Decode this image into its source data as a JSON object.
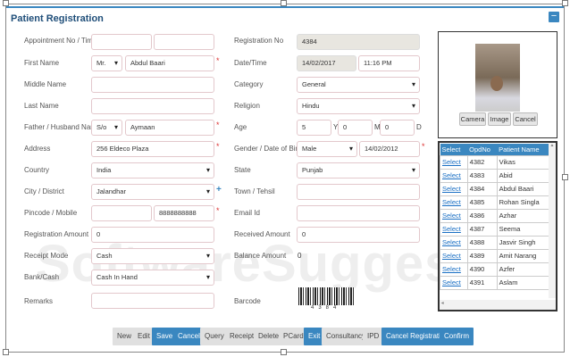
{
  "title": "Patient Registration",
  "collapse_label": "−",
  "left": {
    "appointment": {
      "label": "Appointment No / Time",
      "no": "",
      "time": ""
    },
    "first_name": {
      "label": "First Name",
      "prefix": "Mr.",
      "value": "Abdul Baari",
      "req": "*"
    },
    "middle_name": {
      "label": "Middle Name",
      "value": ""
    },
    "last_name": {
      "label": "Last Name",
      "value": ""
    },
    "father": {
      "label": "Father / Husband Name",
      "prefix": "S/o",
      "value": "Aymaan",
      "req": "*"
    },
    "address": {
      "label": "Address",
      "value": "256 Eldeco Plaza",
      "req": "*"
    },
    "country": {
      "label": "Country",
      "value": "India"
    },
    "city": {
      "label": "City / District",
      "value": "Jalandhar",
      "plus": "+"
    },
    "pincode": {
      "label": "Pincode / Mobile",
      "pincode": "",
      "mobile": "8888888888",
      "req": "*"
    },
    "reg_amount": {
      "label": "Registration Amount",
      "value": "0"
    },
    "receipt_mode": {
      "label": "Receipt Mode",
      "value": "Cash"
    },
    "bank": {
      "label": "Bank/Cash",
      "value": "Cash In Hand"
    },
    "remarks": {
      "label": "Remarks",
      "value": ""
    }
  },
  "right": {
    "reg_no": {
      "label": "Registration No",
      "value": "4384"
    },
    "datetime": {
      "label": "Date/Time",
      "date": "14/02/2017",
      "time": "11:16 PM"
    },
    "category": {
      "label": "Category",
      "value": "General"
    },
    "religion": {
      "label": "Religion",
      "value": "Hindu"
    },
    "age": {
      "label": "Age",
      "y": "5",
      "m": "0",
      "d": "0",
      "y_unit": "Y",
      "m_unit": "M",
      "d_unit": "D"
    },
    "gender": {
      "label": "Gender / Date of Birth",
      "gender": "Male",
      "dob": "14/02/2012",
      "req": "*"
    },
    "state": {
      "label": "State",
      "value": "Punjab"
    },
    "town": {
      "label": "Town / Tehsil",
      "value": ""
    },
    "email": {
      "label": "Email Id",
      "value": ""
    },
    "received": {
      "label": "Received Amount",
      "value": "0"
    },
    "balance": {
      "label": "Balance Amount",
      "value": "0"
    },
    "barcode": {
      "label": "Barcode",
      "digits": "4384"
    }
  },
  "photo": {
    "camera": "Camera",
    "image": "Image",
    "cancel": "Cancel"
  },
  "patients": {
    "headers": [
      "Select",
      "OpdNo",
      "Patient Name"
    ],
    "link": "Select",
    "rows": [
      [
        "4382",
        "Vikas"
      ],
      [
        "4383",
        "Abid"
      ],
      [
        "4384",
        "Abdul Baari"
      ],
      [
        "4385",
        "Rohan Singla"
      ],
      [
        "4386",
        "Azhar"
      ],
      [
        "4387",
        "Seema"
      ],
      [
        "4388",
        "Jasvir Singh"
      ],
      [
        "4389",
        "Amit Narang"
      ],
      [
        "4390",
        "Azfer"
      ],
      [
        "4391",
        "Aslam"
      ]
    ]
  },
  "buttons": [
    "New",
    "Edit",
    "Save",
    "Cancel",
    "Query",
    "Receipt",
    "Delete",
    "PCard",
    "Exit",
    "Consultancy",
    "IPD",
    "Cancel Registration",
    "Confirm"
  ],
  "watermark": "SoftwareSuggest"
}
